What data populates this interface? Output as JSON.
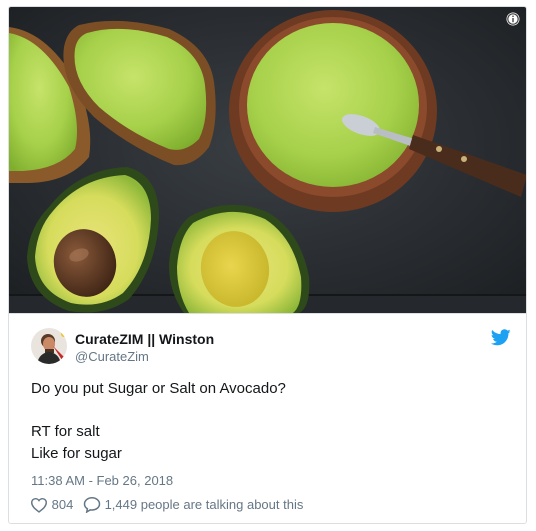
{
  "tweet": {
    "display_name": "CurateZIM || Winston",
    "handle": "@CurateZim",
    "lines": [
      "Do you put Sugar or Salt on Avocado?",
      "RT for salt",
      "Like for sugar"
    ],
    "timestamp": "11:38 AM - Feb 26, 2018",
    "like_count": "804",
    "talking_text": "1,449 people are talking about this"
  },
  "icons": {
    "info": "info-icon",
    "platform": "twitter-bird-icon",
    "like": "heart-icon",
    "reply": "speech-bubble-icon"
  },
  "colors": {
    "twitter_blue": "#1da1f2",
    "text": "#14171a",
    "muted": "#657786",
    "border": "#dcdfe2"
  }
}
